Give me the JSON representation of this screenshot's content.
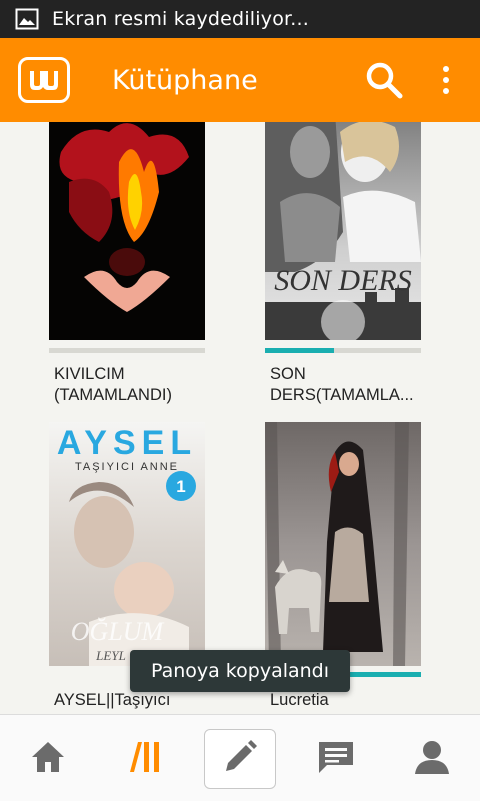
{
  "status_bar": {
    "notification_icon": "image-icon",
    "text": "Ekran resmi kaydediliyor..."
  },
  "app_bar": {
    "logo_icon": "wattpad-logo-icon",
    "title": "Kütüphane",
    "search_icon": "search-icon",
    "menu_icon": "overflow-menu-icon",
    "background": "#ff8c00"
  },
  "library": {
    "books": [
      {
        "title": "KIVILCIM\n(TAMAMLANDI)",
        "progress": 0.0
      },
      {
        "title": "SON\nDERS(TAMAMLA...",
        "progress": 0.44,
        "cover_text": "SON DERS"
      },
      {
        "title": "AYSEL||Taşıyıcı\nA...",
        "progress": 0.0,
        "cover_title": "AYSEL",
        "cover_subtitle": "TAŞIYICI ANNE",
        "cover_badge": "1",
        "cover_footer": "OĞLUM",
        "cover_author": "LEYL"
      },
      {
        "title": "Lucretia",
        "progress": 1.0
      }
    ]
  },
  "toast": {
    "text": "Panoya kopyalandı"
  },
  "bottom_nav": {
    "items": [
      {
        "name": "home",
        "icon": "home-icon"
      },
      {
        "name": "library",
        "icon": "library-icon",
        "active": true
      },
      {
        "name": "write",
        "icon": "pencil-icon"
      },
      {
        "name": "messages",
        "icon": "message-icon"
      },
      {
        "name": "profile",
        "icon": "profile-icon"
      }
    ]
  },
  "colors": {
    "accent": "#ff8c00",
    "progress": "#1aaeb0",
    "toast_bg": "#2d3838"
  }
}
